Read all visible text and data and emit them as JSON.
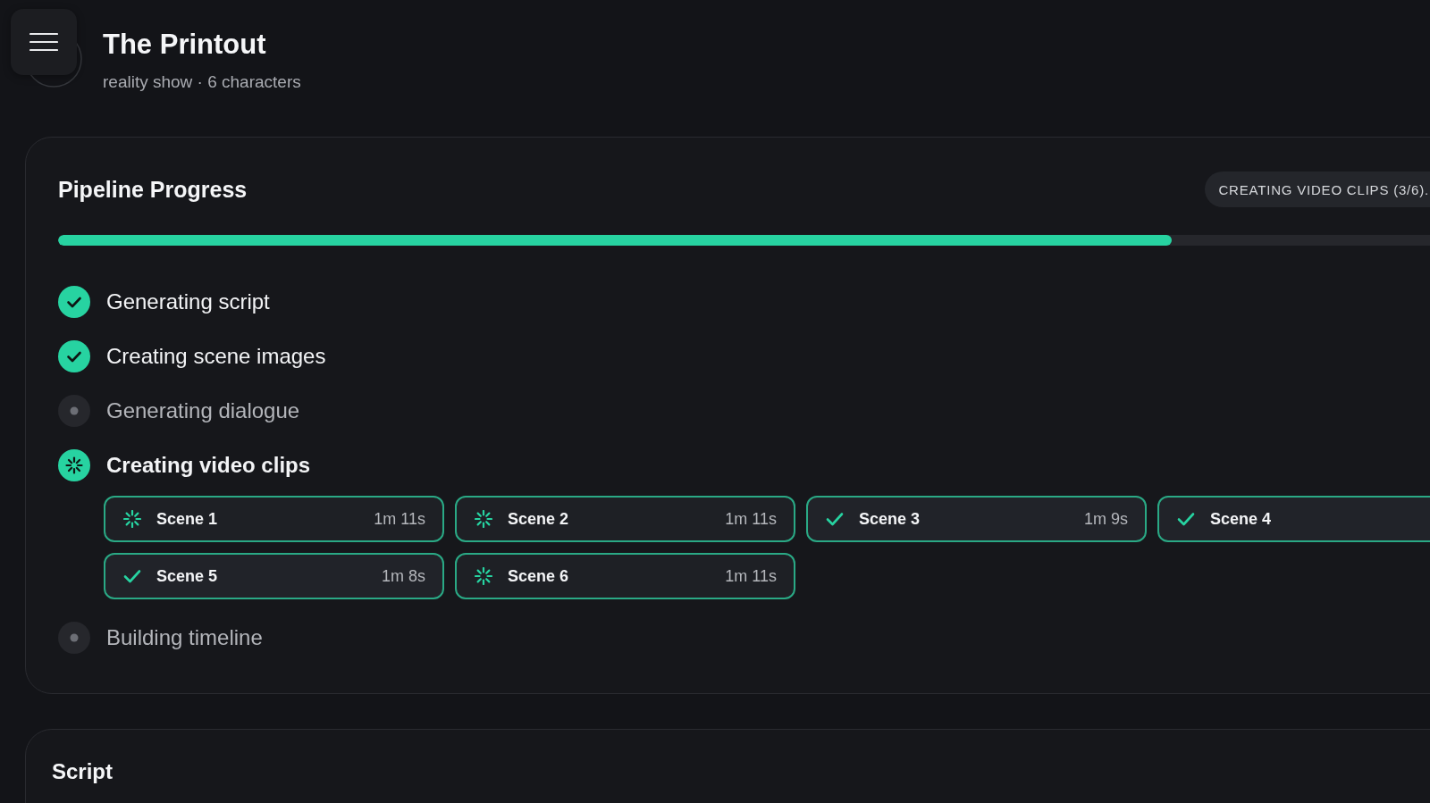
{
  "header": {
    "title": "The Printout",
    "subtitle": "reality show · 6 characters"
  },
  "pipeline": {
    "title": "Pipeline Progress",
    "status_badge": "CREATING VIDEO CLIPS (3/6).",
    "progress": {
      "level": 0.8
    },
    "steps": [
      {
        "label": "Generating script",
        "done": true,
        "active": false
      },
      {
        "label": "Creating scene images",
        "done": true,
        "active": false
      },
      {
        "label": "Generating dialogue",
        "done": false,
        "active": false
      },
      {
        "label": "Creating video clips",
        "done": false,
        "active": true,
        "scenes": [
          {
            "name": "Scene 1",
            "done": false,
            "time": "1m 11s"
          },
          {
            "name": "Scene 2",
            "done": false,
            "time": "1m 11s"
          },
          {
            "name": "Scene 3",
            "done": true,
            "time": "1m 9s"
          },
          {
            "name": "Scene 4",
            "done": true
          },
          {
            "name": "Scene 5",
            "done": true,
            "time": "1m 8s"
          },
          {
            "name": "Scene 6",
            "done": false,
            "time": "1m 11s"
          }
        ]
      },
      {
        "label": "Building timeline",
        "done": false,
        "active": false
      }
    ]
  },
  "script": {
    "title": "Script"
  }
}
